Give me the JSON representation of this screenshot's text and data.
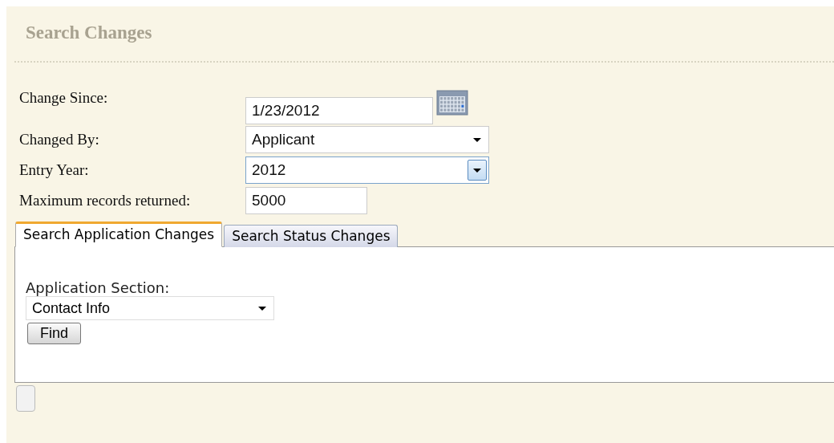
{
  "title": "Search Changes",
  "fields": [
    {
      "label": "Change Since:",
      "kind": "date",
      "value": "1/23/2012",
      "focused": false
    },
    {
      "label": "Changed By:",
      "kind": "select",
      "value": "Applicant",
      "focused": false
    },
    {
      "label": "Entry Year:",
      "kind": "select",
      "value": "2012",
      "focused": true
    },
    {
      "label": "Maximum records returned:",
      "kind": "text",
      "value": "5000",
      "focused": false
    }
  ],
  "tabs": [
    {
      "label": "Search Application Changes",
      "selected": true
    },
    {
      "label": "Search Status Changes",
      "selected": false
    }
  ],
  "panel": {
    "section_label": "Application Section:",
    "section_value": "Contact Info",
    "button": "Find"
  }
}
